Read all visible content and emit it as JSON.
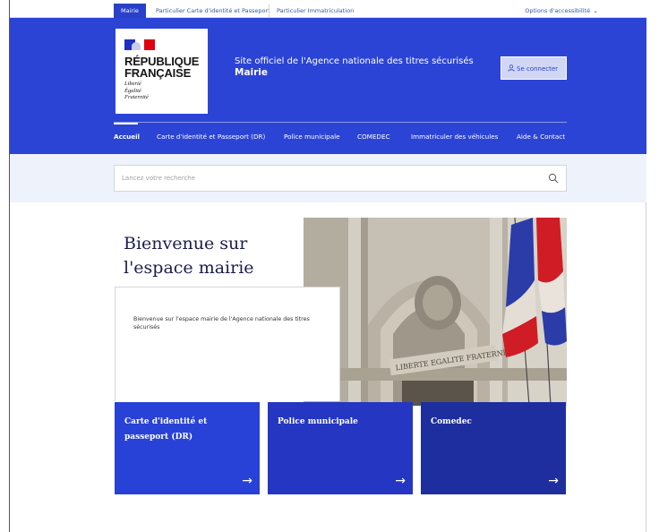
{
  "topnav": {
    "tabs": [
      "Mairie",
      "Particulier Carte d'identité et Passeport",
      "Particulier Immatriculation"
    ],
    "accessibility": "Options d'accessibilité"
  },
  "header": {
    "brand_line1": "RÉPUBLIQUE",
    "brand_line2": "FRANÇAISE",
    "motto": [
      "Liberté",
      "Égalité",
      "Fraternité"
    ],
    "site_title": "Site officiel de l'Agence nationale des titres sécurisés",
    "site_subtitle": "Mairie",
    "login_label": "Se connecter"
  },
  "mainnav": [
    "Accueil",
    "Carte d'identité et Passeport (DR)",
    "Police municipale",
    "COMEDEC",
    "Immatriculer des véhicules",
    "Aide & Contact"
  ],
  "search": {
    "placeholder": "Lancez votre recherche"
  },
  "hero": {
    "title": "Bienvenue sur l'espace mairie",
    "intro": "Bienvenue sur l'espace mairie de l'Agence nationale des titres sécurisés",
    "photo_inscription": "LIBERTE EGALITE FRATERNITE"
  },
  "tiles": [
    {
      "label": "Carte d'identité et passeport (DR)",
      "arrow": "→"
    },
    {
      "label": "Police municipale",
      "arrow": "→"
    },
    {
      "label": "Comedec",
      "arrow": "→"
    }
  ],
  "colors": {
    "header_blue": "#2b44d6",
    "tile1": "#2841d6",
    "tile2": "#2436c2",
    "tile3": "#1e2e9e",
    "flag_red": "#e1000f",
    "hero_title": "#1b1e4d"
  }
}
